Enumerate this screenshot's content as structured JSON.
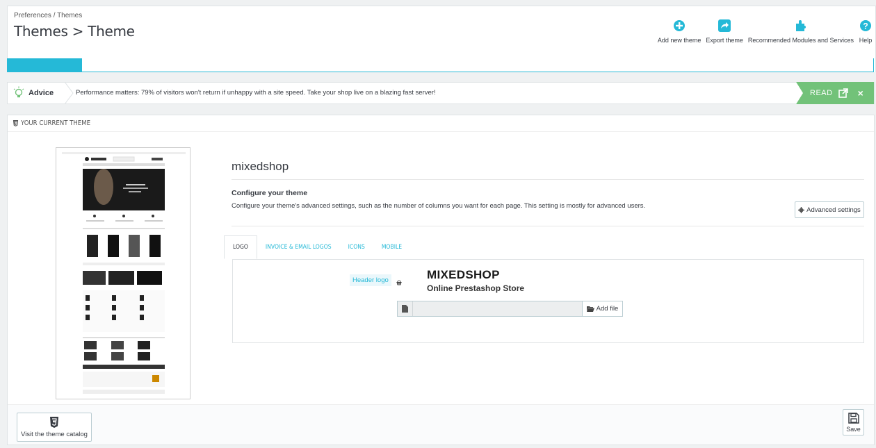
{
  "header": {
    "breadcrumb": "Preferences  /  Themes",
    "title": "Themes > Theme",
    "toolbar": [
      {
        "label": "Add new theme",
        "icon": "plus-circle-icon"
      },
      {
        "label": "Export theme",
        "icon": "share-icon"
      },
      {
        "label": "Recommended Modules and Services",
        "icon": "puzzle-icon"
      },
      {
        "label": "Help",
        "icon": "question-circle-icon"
      }
    ]
  },
  "advice": {
    "label": "Advice",
    "text": "Performance matters: 79% of visitors won't return if unhappy with a site speed. Take your shop live on a blazing fast server!",
    "read_label": "READ",
    "close_label": "×"
  },
  "panel": {
    "heading": "YOUR CURRENT THEME",
    "theme_name": "mixedshop",
    "configure_title": "Configure your theme",
    "configure_desc": "Configure your theme's advanced settings, such as the number of columns you want for each page. This setting is mostly for advanced users.",
    "advanced_settings_label": "Advanced settings",
    "tabs": [
      {
        "label": "LOGO",
        "active": true
      },
      {
        "label": "INVOICE & EMAIL LOGOS",
        "active": false
      },
      {
        "label": "ICONS",
        "active": false
      },
      {
        "label": "MOBILE",
        "active": false
      }
    ],
    "header_logo_label": "Header logo",
    "logo_title": "MIXEDSHOP",
    "logo_subtitle": "Online Prestashop Store",
    "add_file_label": "Add file",
    "catalog_label": "Visit the theme catalog",
    "save_label": "Save"
  },
  "colors": {
    "accent": "#25b9d7",
    "advice_green": "#72c279"
  }
}
